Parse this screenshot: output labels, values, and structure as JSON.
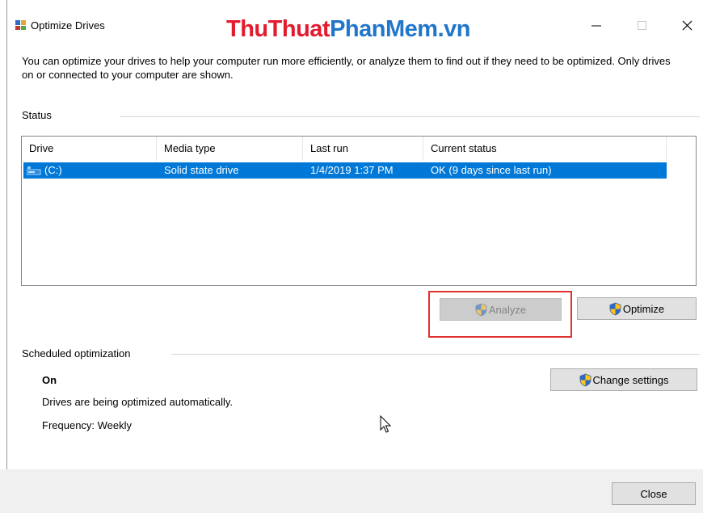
{
  "window": {
    "title": "Optimize Drives",
    "watermark_part1": "ThuThuat",
    "watermark_part2": "PhanMem",
    "watermark_part3": ".vn"
  },
  "description": "You can optimize your drives to help your computer run more efficiently, or analyze them to find out if they need to be optimized. Only drives on or connected to your computer are shown.",
  "status": {
    "label": "Status",
    "columns": [
      "Drive",
      "Media type",
      "Last run",
      "Current status"
    ],
    "drives": [
      {
        "drive": "(C:)",
        "media_type": "Solid state drive",
        "last_run": "1/4/2019 1:37 PM",
        "current_status": "OK (9 days since last run)"
      }
    ]
  },
  "actions": {
    "analyze_label": "Analyze",
    "optimize_label": "Optimize"
  },
  "schedule": {
    "label": "Scheduled optimization",
    "state": "On",
    "description": "Drives are being optimized automatically.",
    "frequency": "Frequency: Weekly",
    "change_settings_label": "Change settings"
  },
  "footer": {
    "close_label": "Close"
  },
  "colors": {
    "selection": "#0078d7",
    "highlight_box": "#e0302f",
    "watermark_red": "#e31b2e",
    "watermark_blue": "#2176c9"
  },
  "icons": [
    "defrag-app-icon",
    "drive-icon",
    "uac-shield-icon",
    "minimize-icon",
    "maximize-icon",
    "close-icon",
    "mouse-cursor-icon"
  ]
}
